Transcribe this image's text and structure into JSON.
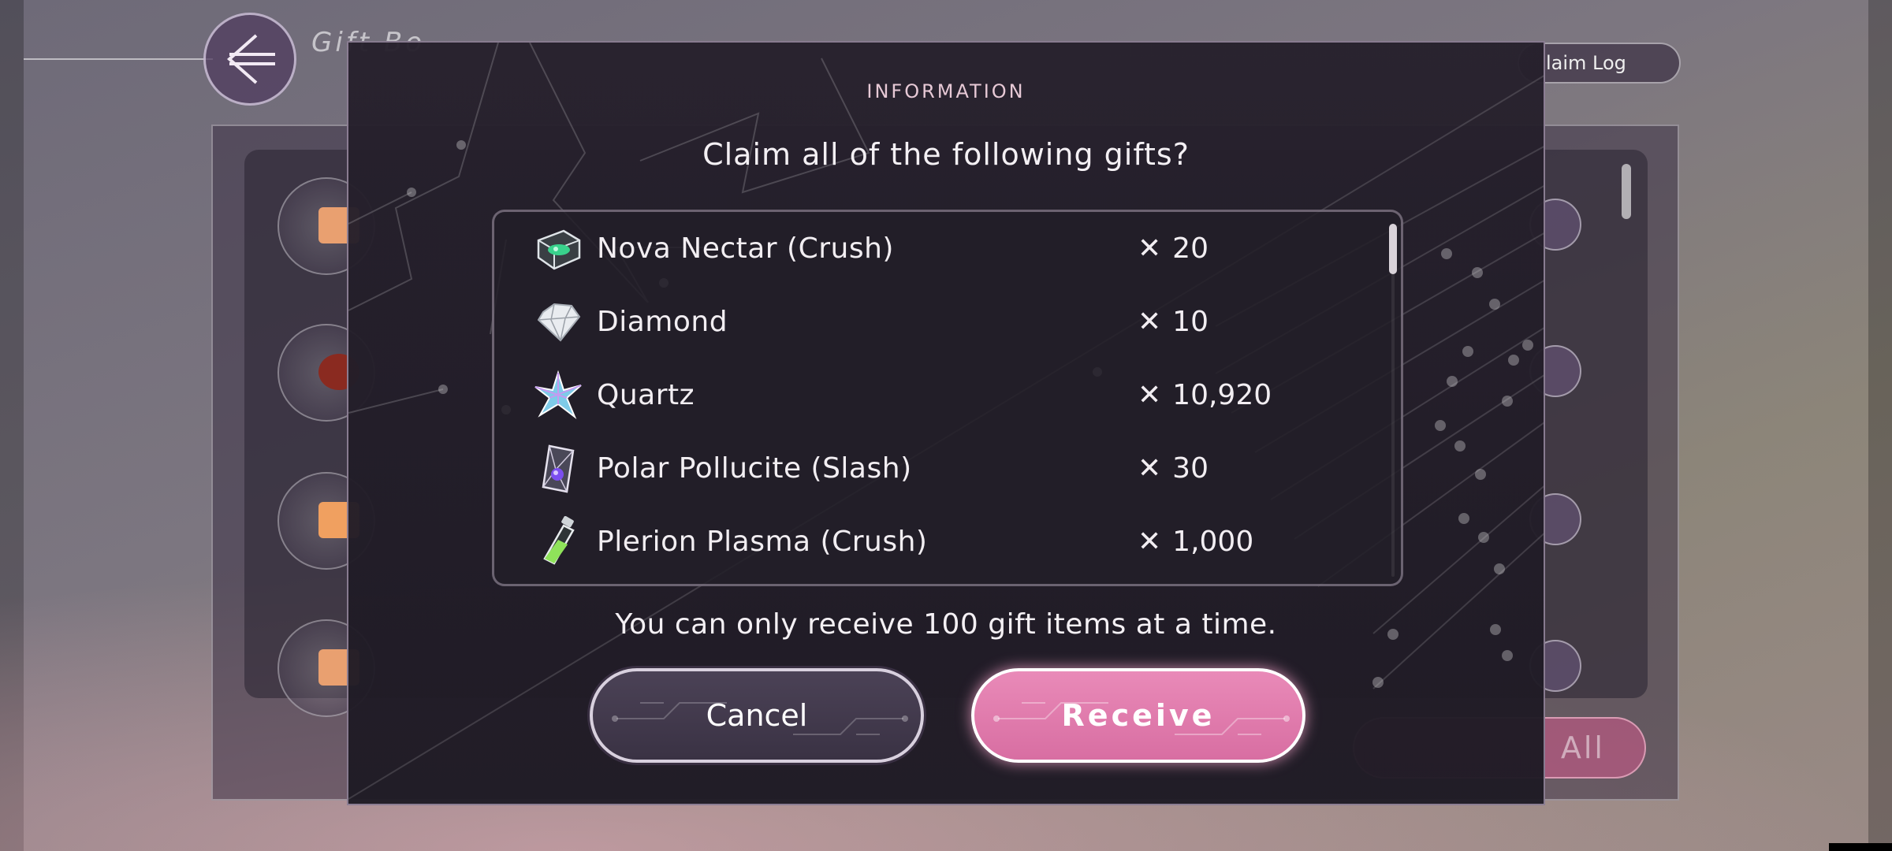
{
  "background": {
    "title": "Gift Bo",
    "claim_log_label": "laim Log",
    "receive_all_label": "All"
  },
  "modal": {
    "header": "INFORMATION",
    "question": "Claim all of the following gifts?",
    "limit_note": "You can only receive 100 gift items at a time.",
    "cancel_label": "Cancel",
    "receive_label": "Receive",
    "gifts": [
      {
        "icon": "nova-nectar-icon",
        "name": "Nova Nectar (Crush)",
        "quantity": "20"
      },
      {
        "icon": "diamond-icon",
        "name": "Diamond",
        "quantity": "10"
      },
      {
        "icon": "quartz-icon",
        "name": "Quartz",
        "quantity": "10,920"
      },
      {
        "icon": "polar-pollucite-icon",
        "name": "Polar Pollucite (Slash)",
        "quantity": "30"
      },
      {
        "icon": "plerion-plasma-icon",
        "name": "Plerion Plasma (Crush)",
        "quantity": "1,000"
      }
    ],
    "multiply_sign": "✕"
  },
  "colors": {
    "accent_pink": "#e07aae",
    "modal_bg": "#26202c",
    "text": "#f4f0f4"
  }
}
